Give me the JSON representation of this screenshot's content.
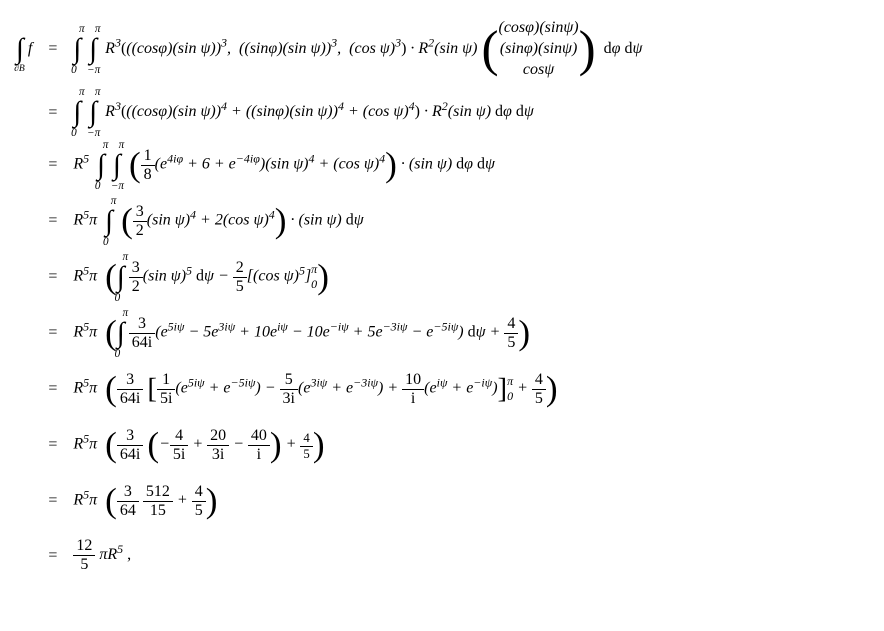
{
  "lhs": "∫<sub>∂B</sub> f",
  "eq_sign": "=",
  "rows": [
    "∫<sub>0</sub><sup>π</sup> ∫<sub>−π</sub><sup>π</sup> R³(((cosφ)(sin ψ))³,  ((sinφ)(sin ψ))³,  (cos ψ)³) · R²(sin ψ) ((cosφ)(sinψ); (sinφ)(sinψ); cosψ) dφ dψ",
    "∫<sub>0</sub><sup>π</sup> ∫<sub>−π</sub><sup>π</sup> R³(((cosφ)(sin ψ))⁴ + ((sinφ)(sin ψ))⁴ + (cos ψ)⁴) · R²(sin ψ) dφ dψ",
    "R⁵ ∫<sub>0</sub><sup>π</sup> ∫<sub>−π</sub><sup>π</sup> (1/8 (e^{4iφ} + 6 + e^{−4iφ})(sin ψ)⁴ + (cos ψ)⁴) · (sin ψ) dφ dψ",
    "R⁵π ∫<sub>0</sub><sup>π</sup> (3/2 (sin ψ)⁴ + 2(cos ψ)⁴) · (sin ψ) dψ",
    "R⁵π (∫<sub>0</sub><sup>π</sup> 3/2 (sin ψ)⁵ dψ − 2/5 [(cos ψ)⁵]<sub>0</sub><sup>π</sup>)",
    "R⁵π (∫<sub>0</sub><sup>π</sup> 3/(64i) (e^{5iψ} − 5e^{3iψ} + 10e^{iψ} − 10e^{−iψ} + 5e^{−3iψ} − e^{−5iψ}) dψ + 4/5)",
    "R⁵π (3/(64i) [1/(5i)(e^{5iψ}+e^{−5iψ}) − 5/(3i)(e^{3iψ}+e^{−3iψ}) + 10/i (e^{iψ}+e^{−iψ})]<sub>0</sub><sup>π</sup> + 4/5)",
    "R⁵π (3/(64i) (−4/(5i) + 20/(3i) − 40/i) + 4/5)",
    "R⁵π (3/64 · 512/15 + 4/5)",
    "12/5 πR⁵ ,"
  ],
  "chart_data": {
    "type": "table",
    "title": "Surface integral computation over ∂B",
    "left_side": "∫_{∂B} f",
    "steps": 10,
    "final_result": "(12/5) π R⁵"
  }
}
